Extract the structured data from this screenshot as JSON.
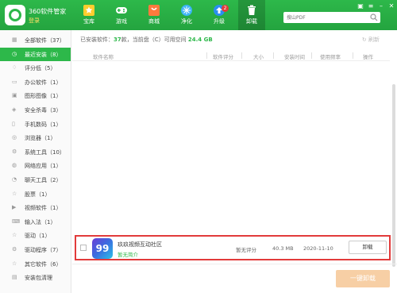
{
  "header": {
    "app_name": "360软件管家",
    "login": "登录",
    "nav": [
      {
        "label": "宝库",
        "icon": "star-icon"
      },
      {
        "label": "游戏",
        "icon": "gamepad-icon"
      },
      {
        "label": "商城",
        "icon": "shop-icon"
      },
      {
        "label": "净化",
        "icon": "clean-icon"
      },
      {
        "label": "升级",
        "icon": "upgrade-icon",
        "badge": "2"
      },
      {
        "label": "卸载",
        "icon": "trash-icon",
        "active": true
      }
    ],
    "search_placeholder": "搜山PDF",
    "colors": {
      "brand": "#2db84a",
      "badge": "#e23b3b"
    }
  },
  "sidebar": {
    "items": [
      {
        "label": "全部软件（37）",
        "icon": "grid-icon"
      },
      {
        "label": "最近安装（8）",
        "icon": "clock-icon",
        "active": true
      },
      {
        "label": "评分低（5）",
        "icon": "thumbs-down-icon"
      },
      {
        "label": "办公软件（1）",
        "icon": "briefcase-icon"
      },
      {
        "label": "图形图像（1）",
        "icon": "image-icon"
      },
      {
        "label": "安全杀毒（3）",
        "icon": "shield-icon"
      },
      {
        "label": "手机数码（1）",
        "icon": "phone-icon"
      },
      {
        "label": "浏览器（1）",
        "icon": "browser-icon"
      },
      {
        "label": "系统工具（10）",
        "icon": "tool-icon"
      },
      {
        "label": "网络应用（1）",
        "icon": "globe-icon"
      },
      {
        "label": "聊天工具（2）",
        "icon": "chat-icon"
      },
      {
        "label": "股票（1）",
        "icon": "star-outline-icon"
      },
      {
        "label": "视频软件（1）",
        "icon": "video-icon"
      },
      {
        "label": "输入法（1）",
        "icon": "keyboard-icon"
      },
      {
        "label": "驱动（1）",
        "icon": "star-outline-icon"
      },
      {
        "label": "驱动程序（7）",
        "icon": "driver-icon"
      },
      {
        "label": "其它软件（6）",
        "icon": "star-outline-icon"
      },
      {
        "label": "安装包清理",
        "icon": "package-icon"
      }
    ]
  },
  "main": {
    "stats_prefix": "已安装软件：",
    "stats_count": "37",
    "stats_mid": "款，当前盘（C）可用空间",
    "stats_space": "24.4 GB",
    "refresh_label": "刷新",
    "columns": [
      "软件名称",
      "软件评分",
      "大小",
      "安装时间",
      "使用频率",
      "操作"
    ],
    "row": {
      "name": "玖玖视频互动社区",
      "icon_text": "99",
      "desc": "暂无简介",
      "rating": "暂无评分",
      "size": "40.3 MB",
      "date": "2020-11-10",
      "freq": "--",
      "action": "卸载"
    },
    "batch_uninstall": "一键卸载"
  }
}
